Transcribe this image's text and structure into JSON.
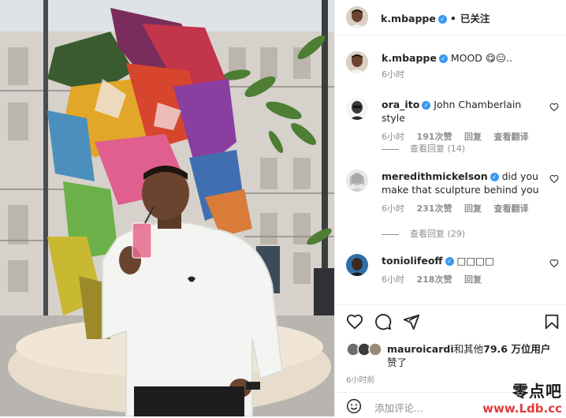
{
  "post": {
    "author": "k.mbappe",
    "follow_status": "已关注",
    "caption_text": "MOOD",
    "caption_emojis": "😋😑..",
    "caption_time": "6小时"
  },
  "comments": [
    {
      "username": "ora_ito",
      "text": "John Chamberlain style",
      "time": "6小时",
      "likes": "191次赞",
      "reply": "回复",
      "translate": "查看翻译",
      "view_replies": "查看回复 (14)"
    },
    {
      "username": "meredithmickelson",
      "text": "did you make that sculpture behind you",
      "time": "6小时",
      "likes": "231次赞",
      "reply": "回复",
      "translate": "查看翻译",
      "view_replies": "查看回复 (29)"
    },
    {
      "username": "toniolifeoff",
      "text": "□□□□",
      "time": "6小时",
      "likes": "218次赞",
      "reply": "回复"
    }
  ],
  "likes_summary": {
    "user": "mauroicardi",
    "middle": "和其他",
    "count": "79.6 万位用户",
    "suffix": "赞了"
  },
  "post_time": "6小时前",
  "add_comment_placeholder": "添加评论...",
  "watermark": {
    "title": "零点吧",
    "url": "www.Ldb.cc"
  },
  "icons": [
    "verified-badge",
    "heart-icon",
    "comment-icon",
    "share-icon",
    "bookmark-icon",
    "emoji-icon"
  ],
  "colors": {
    "verified": "#3897f0",
    "text": "#262626",
    "muted": "#8e8e8e",
    "watermark_red": "#e23b3b"
  }
}
